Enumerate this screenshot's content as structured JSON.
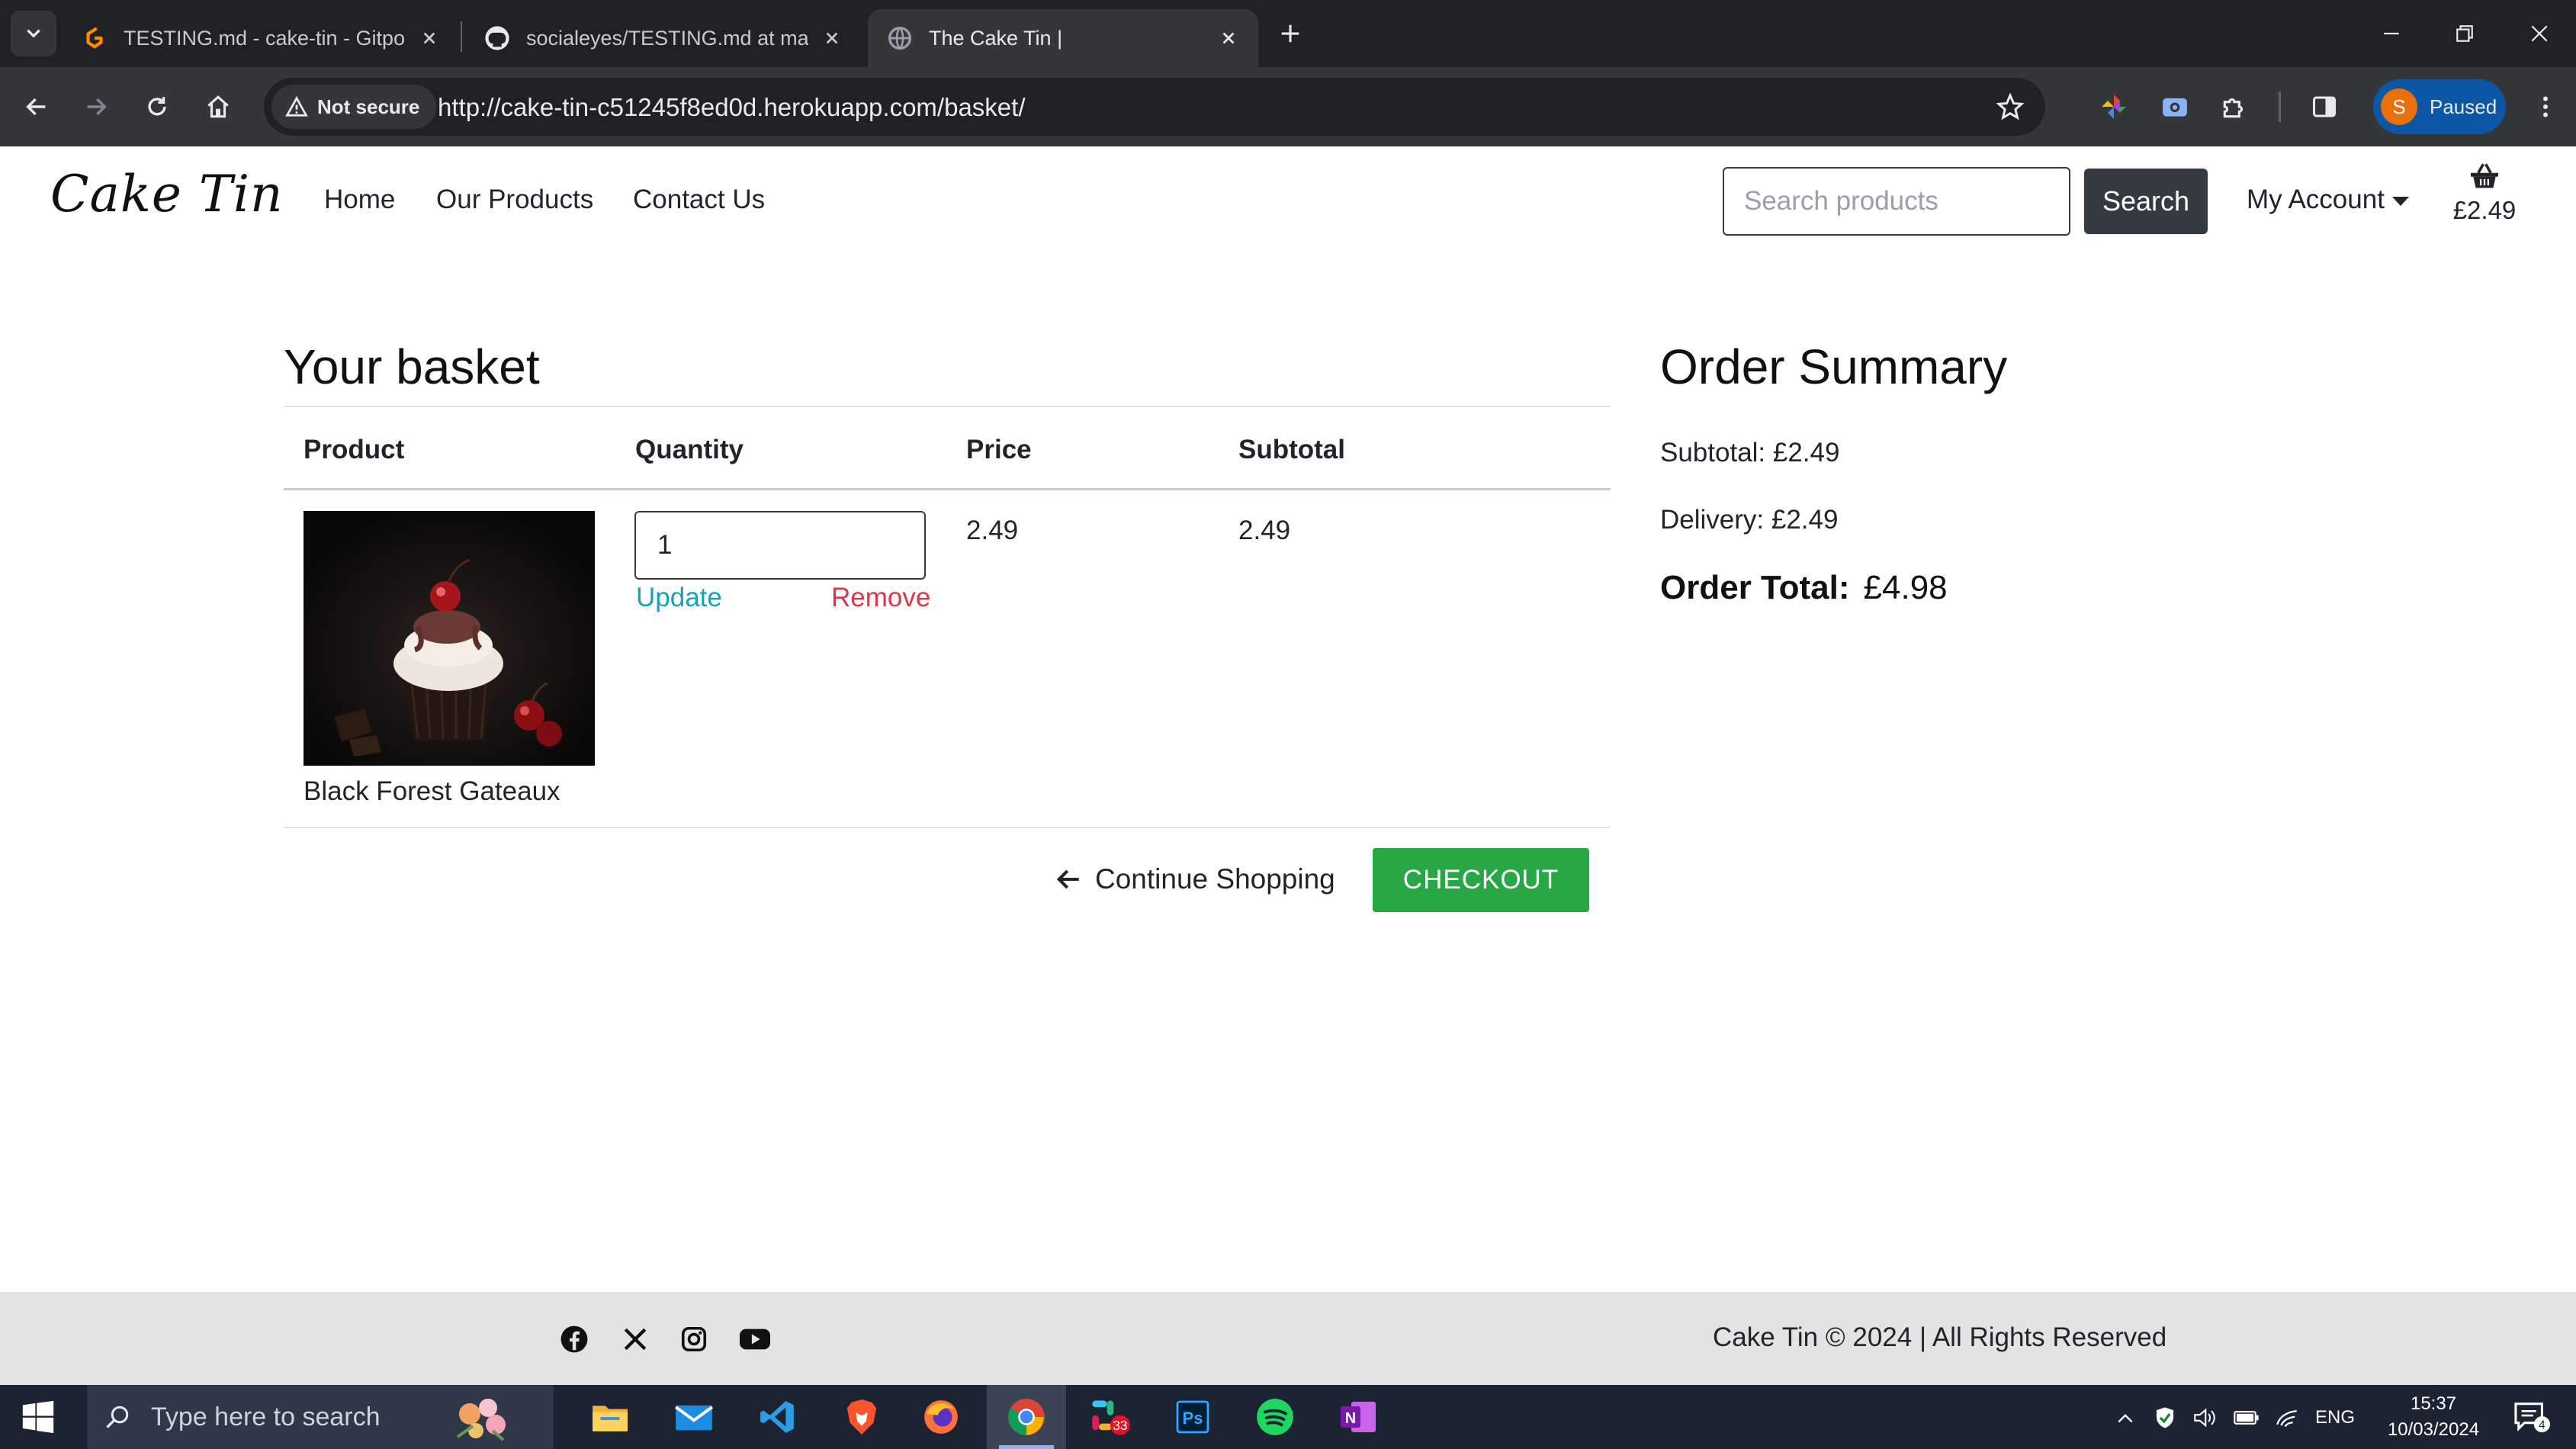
{
  "browser": {
    "tabs": [
      {
        "title": "TESTING.md - cake-tin - Gitpod",
        "active": false
      },
      {
        "title": "socialeyes/TESTING.md at main",
        "active": false
      },
      {
        "title": "The Cake Tin |",
        "active": true
      }
    ],
    "security_label": "Not secure",
    "url": "http://cake-tin-c51245f8ed0d.herokuapp.com/basket/",
    "profile_initial": "S",
    "profile_status": "Paused"
  },
  "site": {
    "logo": "Cake Tin",
    "nav": [
      "Home",
      "Our Products",
      "Contact Us"
    ],
    "search_placeholder": "Search products",
    "search_button": "Search",
    "account_label": "My Account",
    "basket_total": "£2.49"
  },
  "basket": {
    "heading": "Your basket",
    "columns": [
      "Product",
      "Quantity",
      "Price",
      "Subtotal"
    ],
    "items": [
      {
        "name": "Black Forest Gateaux",
        "quantity": "1",
        "price": "2.49",
        "subtotal": "2.49",
        "update_label": "Update",
        "remove_label": "Remove"
      }
    ],
    "continue_label": "Continue Shopping",
    "checkout_label": "CHECKOUT"
  },
  "summary": {
    "heading": "Order Summary",
    "subtotal": "Subtotal: £2.49",
    "delivery": "Delivery: £2.49",
    "total_label": "Order Total:",
    "total_value": "£4.98"
  },
  "footer": {
    "social_icons": [
      "facebook-icon",
      "x-icon",
      "instagram-icon",
      "youtube-icon"
    ],
    "copyright": "Cake Tin © 2024 | All Rights Reserved"
  },
  "taskbar": {
    "search_placeholder": "Type here to search",
    "apps": [
      "file-explorer",
      "mail",
      "vscode",
      "brave",
      "firefox",
      "chrome",
      "slack",
      "photoshop",
      "spotify",
      "onenote"
    ],
    "slack_badge": "33",
    "language": "ENG",
    "time": "15:37",
    "date": "10/03/2024",
    "notification_count": "4"
  },
  "colors": {
    "browser_dark": "#202124",
    "toolbar": "#35363a",
    "checkout_green": "#28a745",
    "update_teal": "#17a2b8",
    "remove_red": "#dc3545",
    "footer_gray": "#e3e3e3",
    "taskbar": "#1c2433"
  }
}
